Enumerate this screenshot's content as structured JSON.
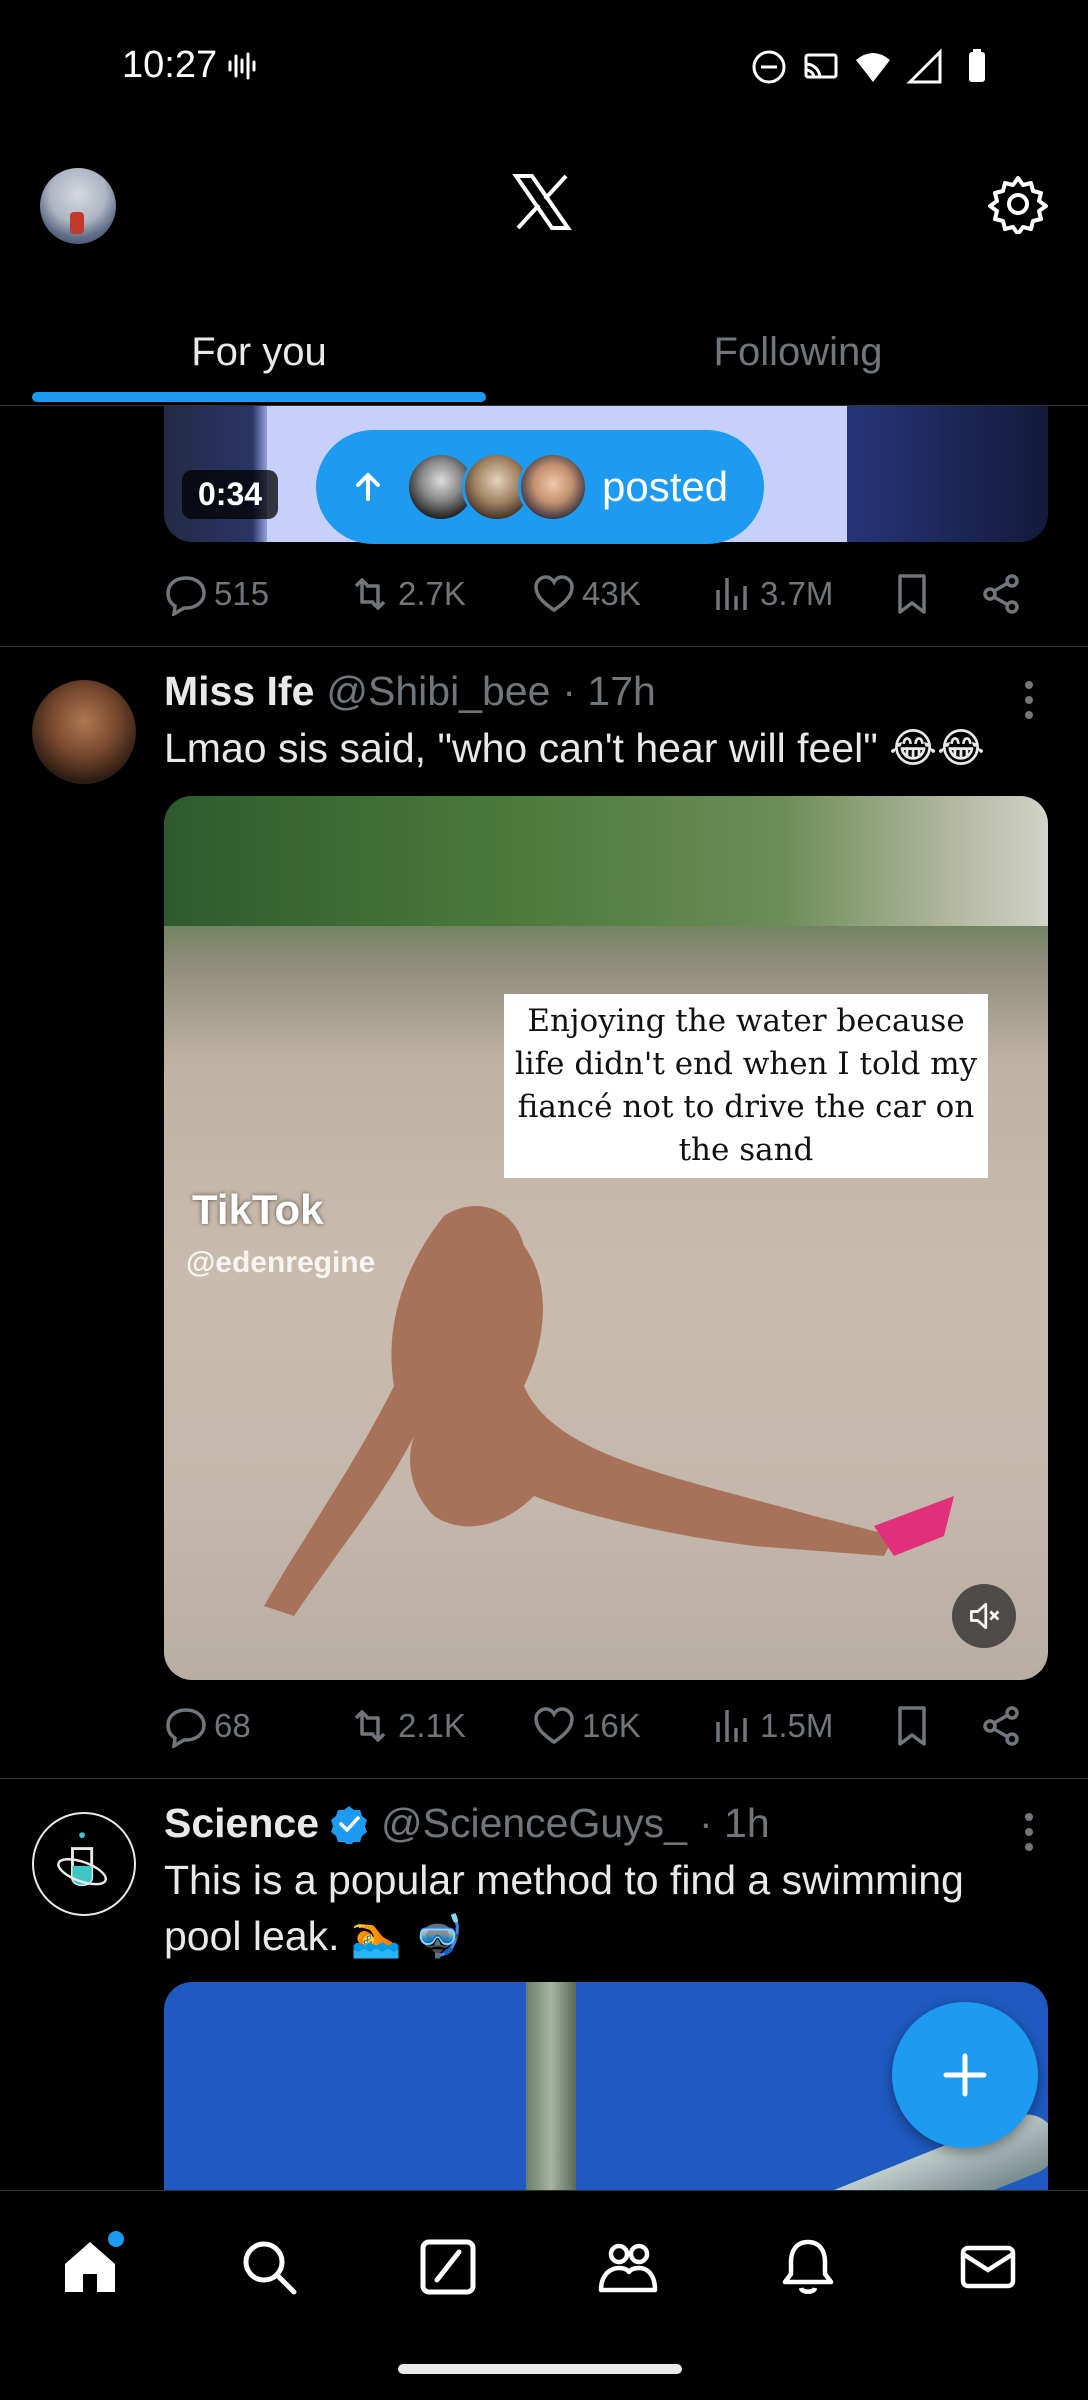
{
  "status_bar": {
    "time": "10:27"
  },
  "tabs": {
    "for_you": "For you",
    "following": "Following"
  },
  "pill": {
    "label": "posted"
  },
  "video_card": {
    "duration": "0:34"
  },
  "tweet1_actions": {
    "replies": "515",
    "reposts": "2.7K",
    "likes": "43K",
    "views": "3.7M"
  },
  "tweet2": {
    "name": "Miss Ife",
    "handle": "@Shibi_bee",
    "time": "· 17h",
    "text": "Lmao sis said, \"who can't hear will feel\" 😂😂",
    "media_caption": "Enjoying  the water because life didn't end when I told my fiancé not to drive the car on the sand",
    "watermark": "TikTok",
    "watermark_handle": "@edenregine",
    "replies": "68",
    "reposts": "2.1K",
    "likes": "16K",
    "views": "1.5M"
  },
  "tweet3": {
    "name": "Science",
    "handle": "@ScienceGuys_",
    "time": "· 1h",
    "text": "This is a popular method to find a swimming pool leak. 🏊 🤿"
  },
  "colors": {
    "accent": "#1d9bf0",
    "muted": "#71767b",
    "text": "#e7e9ea",
    "divider": "#2f3336"
  },
  "icons": [
    "x-logo-icon",
    "gear-icon",
    "reply-icon",
    "repost-icon",
    "like-icon",
    "views-icon",
    "bookmark-icon",
    "share-icon",
    "home-icon",
    "search-icon",
    "grok-icon",
    "communities-icon",
    "notifications-icon",
    "messages-icon",
    "compose-plus-icon",
    "mute-icon"
  ]
}
